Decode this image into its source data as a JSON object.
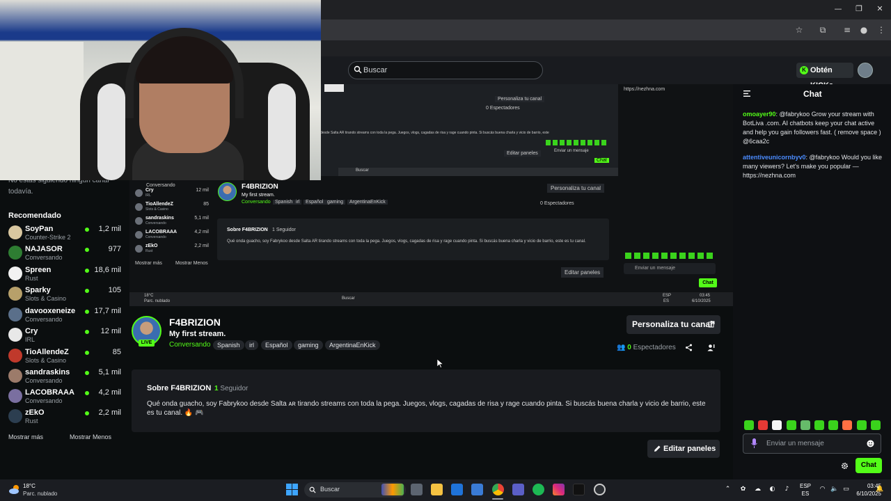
{
  "header": {
    "search_placeholder": "Buscar",
    "get_kicks_label": "Obtén KICKs"
  },
  "sidebar": {
    "follow_note": "No estás siguiendo ningún canal todavía.",
    "recommended_title": "Recomendado",
    "items": [
      {
        "name": "SoyPan",
        "category": "Counter-Strike 2",
        "viewers": "1,2 mil",
        "avatar_color": "#d9c7a0"
      },
      {
        "name": "NAJASOR",
        "category": "Conversando",
        "viewers": "977",
        "avatar_color": "#2e7d32"
      },
      {
        "name": "Spreen",
        "category": "Rust",
        "viewers": "18,6 mil",
        "avatar_color": "#f2f2f2"
      },
      {
        "name": "Sparky",
        "category": "Slots & Casino",
        "viewers": "105",
        "avatar_color": "#b7a06a"
      },
      {
        "name": "davooxeneize",
        "category": "Conversando",
        "viewers": "17,7 mil",
        "avatar_color": "#5a6f8a"
      },
      {
        "name": "Cry",
        "category": "IRL",
        "viewers": "12 mil",
        "avatar_color": "#e8e8e8"
      },
      {
        "name": "TioAllendeZ",
        "category": "Slots & Casino",
        "viewers": "85",
        "avatar_color": "#c0392b"
      },
      {
        "name": "sandraskins",
        "category": "Conversando",
        "viewers": "5,1 mil",
        "avatar_color": "#9c7b6a"
      },
      {
        "name": "LACOBRAAA",
        "category": "Conversando",
        "viewers": "4,2 mil",
        "avatar_color": "#7a6fa0"
      },
      {
        "name": "zEkO",
        "category": "Rust",
        "viewers": "2,2 mil",
        "avatar_color": "#2c3e50"
      }
    ],
    "show_more": "Mostrar más",
    "show_less": "Mostrar Menos"
  },
  "nested": {
    "channel": "F4BRIZION",
    "title": "My first stream.",
    "personalize": "Personaliza tu canal",
    "viewers": "0 Espectadores",
    "about": "Sobre F4BRIZION",
    "followers": "1 Seguidor",
    "about_text": "Qué onda guacho, soy Fabrykoo desde Salta AR tirando streams con toda la pega. Juegos, vlogs, cagadas de risa y rage cuando pinta. Si buscás buena charla y vicio de barrio, este es tu canal.",
    "edit_panels": "Editar paneles",
    "chat_placeholder": "Enviar un mensaje",
    "chat_btn": "Chat",
    "search": "Buscar",
    "weather": "18°C",
    "weather_desc": "Parc. nublado",
    "lang1": "ESP",
    "lang2": "ES",
    "time": "03:45",
    "date": "6/10/2025",
    "side_items": [
      {
        "name": "Cry",
        "cat": "IRL",
        "v": "12 mil"
      },
      {
        "name": "TioAllendeZ",
        "cat": "Slots & Casino",
        "v": "85"
      },
      {
        "name": "sandraskins",
        "cat": "Conversando",
        "v": "5,1 mil"
      },
      {
        "name": "LACOBRAAA",
        "cat": "Conversando",
        "v": "4,2 mil"
      },
      {
        "name": "zEkO",
        "cat": "Rust",
        "v": "2,2 mil"
      }
    ],
    "side_first_cat": "Conversando",
    "show_more": "Mostrar más",
    "show_less": "Mostrar Menos",
    "top_personalize": "Personaliza tu canal",
    "top_edit_panels": "Editar paneles",
    "top_viewers": "0 Espectadores",
    "top_chat_btn": "Chat",
    "top_chat_placeholder": "Enviar un mensaje",
    "top_chat_text": "https://nezhna.com",
    "top_about_text": "desde Salta AR tirando streams con toda la pega. Juegos, vlogs, cagadas de risa y rage cuando pinta. Si buscás buena charla y vicio de barrio, este",
    "top_tags": [
      "Español",
      "gaming",
      "ArgentinaEnKick"
    ],
    "top_search": "Buscar"
  },
  "channel": {
    "name": "F4BRIZION",
    "title": "My first stream.",
    "category": "Conversando",
    "live_label": "LIVE",
    "tags": [
      "Spanish",
      "irl",
      "Español",
      "gaming",
      "ArgentinaEnKick"
    ],
    "personalize_label": "Personaliza tu canal",
    "viewers_count": "0",
    "viewers_label": "Espectadores"
  },
  "about": {
    "title": "Sobre F4BRIZION",
    "followers_count": "1",
    "followers_label": "Seguidor",
    "text": "Qué onda guacho, soy Fabrykoo desde Salta ᴀʀ tirando streams con toda la pega. Juegos, vlogs, cagadas de risa y rage cuando pinta. Si buscás buena charla y vicio de barrio, este es tu canal. 🔥 🎮",
    "edit_panels_label": "Editar paneles"
  },
  "chat": {
    "title": "Chat",
    "messages": [
      {
        "user": "omoayer90",
        "text": ": @fabrykoo Grow your stream with BotLiva .com. AI chatbots keep your chat active and help you gain followers fast. ( remove space ) @6caa2c"
      },
      {
        "user": "attentiveunicornbyv0",
        "text": ": @fabrykoo Would you like many viewers? Let's make you popular — https://nezhna.com"
      }
    ],
    "input_placeholder": "Enviar un mensaje",
    "send_label": "Chat",
    "emote_colors": [
      "#3ad31c",
      "#e53935",
      "#f5f5f5",
      "#3ad31c",
      "#66bb6a",
      "#3ad31c",
      "#3ad31c",
      "#ff7043",
      "#3ad31c",
      "#3ad31c"
    ]
  },
  "taskbar": {
    "weather_temp": "18°C",
    "weather_desc": "Parc. nublado",
    "search_label": "Buscar",
    "lang_top": "ESP",
    "lang_bottom": "ES",
    "time": "03:45",
    "date": "6/10/2025"
  }
}
